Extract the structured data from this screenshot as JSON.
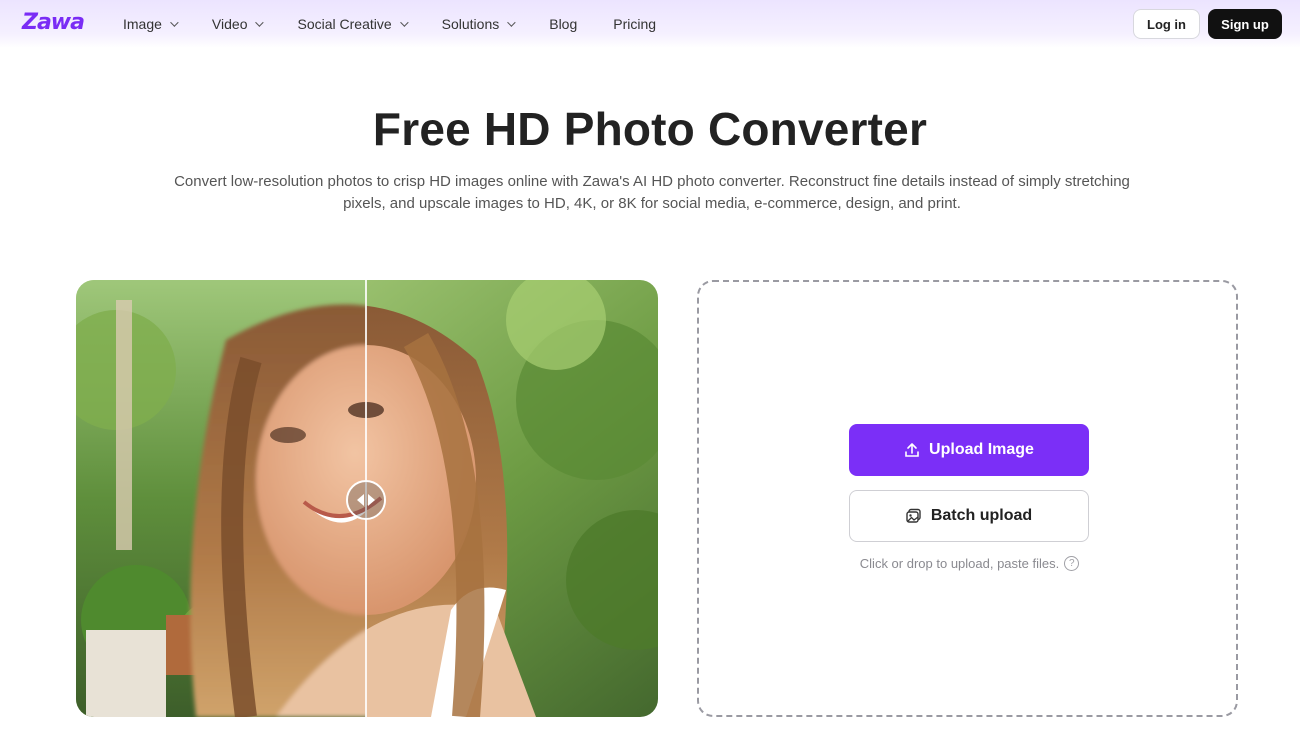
{
  "brand": {
    "logo_text": "Zawa",
    "accent": "#7b2ff7"
  },
  "nav": {
    "items": [
      {
        "label": "Image",
        "has_dropdown": true
      },
      {
        "label": "Video",
        "has_dropdown": true
      },
      {
        "label": "Social Creative",
        "has_dropdown": true
      },
      {
        "label": "Solutions",
        "has_dropdown": true
      },
      {
        "label": "Blog",
        "has_dropdown": false
      },
      {
        "label": "Pricing",
        "has_dropdown": false
      }
    ],
    "login_label": "Log in",
    "signup_label": "Sign up"
  },
  "hero": {
    "title": "Free HD Photo Converter",
    "subtitle": "Convert low-resolution photos to crisp HD images online with Zawa's AI HD photo converter. Reconstruct fine details instead of simply stretching pixels, and upscale images to HD, 4K, or 8K for social media, e-commerce, design, and print."
  },
  "compare": {
    "slider_icon": "compare-arrows-icon"
  },
  "upload": {
    "upload_label": "Upload Image",
    "upload_icon": "upload-icon",
    "batch_label": "Batch upload",
    "batch_icon": "batch-images-icon",
    "hint": "Click or drop to upload, paste files.",
    "help_icon": "question-circle-icon"
  }
}
